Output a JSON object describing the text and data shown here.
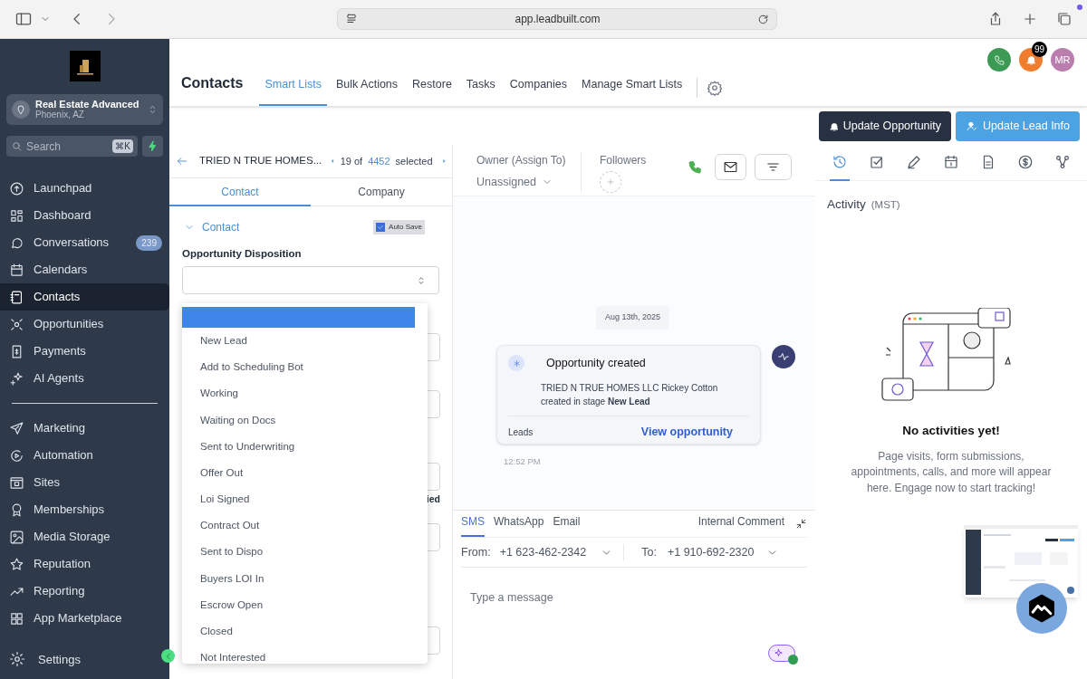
{
  "browser": {
    "url": "app.leadbuilt.com"
  },
  "sidebar": {
    "account": {
      "name": "Real Estate Advanced",
      "location": "Phoenix, AZ"
    },
    "search": {
      "placeholder": "Search",
      "shortcut": "⌘K"
    },
    "items": [
      {
        "label": "Launchpad",
        "selected": false
      },
      {
        "label": "Dashboard",
        "selected": false
      },
      {
        "label": "Conversations",
        "selected": false,
        "badge": "239"
      },
      {
        "label": "Calendars",
        "selected": false
      },
      {
        "label": "Contacts",
        "selected": true
      },
      {
        "label": "Opportunities",
        "selected": false
      },
      {
        "label": "Payments",
        "selected": false
      },
      {
        "label": "AI Agents",
        "selected": false
      }
    ],
    "items_2": [
      {
        "label": "Marketing",
        "selected": false
      },
      {
        "label": "Automation",
        "selected": false
      },
      {
        "label": "Sites",
        "selected": false
      },
      {
        "label": "Memberships",
        "selected": false
      },
      {
        "label": "Media Storage",
        "selected": false
      },
      {
        "label": "Reputation",
        "selected": false
      },
      {
        "label": "Reporting",
        "selected": false
      },
      {
        "label": "App Marketplace",
        "selected": false
      }
    ],
    "settings": "Settings"
  },
  "header": {
    "title": "Contacts",
    "tabs": [
      {
        "label": "Smart Lists",
        "selected": true
      },
      {
        "label": "Bulk Actions",
        "selected": false
      },
      {
        "label": "Restore",
        "selected": false
      },
      {
        "label": "Tasks",
        "selected": false
      },
      {
        "label": "Companies",
        "selected": false
      },
      {
        "label": "Manage Smart Lists",
        "selected": false
      }
    ],
    "notifications": "99",
    "avatar": "MR"
  },
  "actions": [
    "Update Opportunity",
    "Update Lead Info"
  ],
  "record": {
    "name": "TRIED N TRUE HOMES...",
    "position": "19 of",
    "total": "4452",
    "suffix": "selected",
    "tabs": [
      {
        "label": "Contact",
        "selected": true
      },
      {
        "label": "Company",
        "selected": false
      }
    ],
    "section": "Contact",
    "auto_save": {
      "label": "Auto Save",
      "checked": true
    },
    "field_label": "Opportunity Disposition",
    "partial_label": "ied",
    "dropdown": {
      "blank_highlighted": true,
      "options": [
        "New Lead",
        "Add to Scheduling Bot",
        "Working",
        "Waiting on Docs",
        "Sent to Underwriting",
        "Offer Out",
        "Loi Signed",
        "Contract Out",
        "Sent to Dispo",
        "Buyers LOI In",
        "Escrow Open",
        "Closed",
        "Not Interested"
      ]
    }
  },
  "conversation": {
    "owner_label": "Owner (Assign To)",
    "owner": "Unassigned",
    "followers_label": "Followers",
    "date": "Aug 13th, 2025",
    "card": {
      "title": "Opportunity created",
      "body": "TRIED N TRUE HOMES LLC Rickey Cotton created in stage **New Lead**",
      "pipeline": "Leads",
      "link": "View opportunity"
    },
    "time": "12:52 PM",
    "composer": {
      "tabs": [
        {
          "label": "SMS",
          "selected": true
        },
        {
          "label": "WhatsApp",
          "selected": false
        },
        {
          "label": "Email",
          "selected": false
        }
      ],
      "internal": "Internal Comment",
      "from_label": "From:",
      "from": "+1 623-462-2342",
      "to_label": "To:",
      "to": "+1 910-692-2320",
      "placeholder": "Type a message"
    }
  },
  "activity": {
    "tabs": [
      {
        "selected": true
      },
      {
        "selected": false
      },
      {
        "selected": false
      },
      {
        "selected": false
      },
      {
        "selected": false
      },
      {
        "selected": false
      },
      {
        "selected": false
      }
    ],
    "title": "Activity",
    "timezone": "(MST)",
    "empty_title": "No activities yet!",
    "empty_text": "Page visits, form submissions, appointments, calls, and more will appear here. Engage now to start tracking!"
  }
}
